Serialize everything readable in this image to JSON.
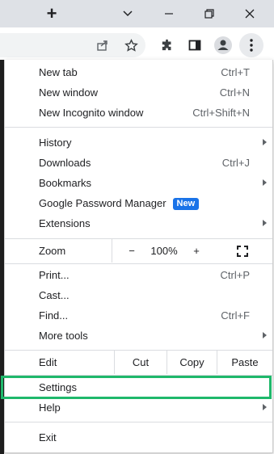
{
  "window": {
    "new_tab_symbol": "+",
    "icons": [
      "new-tab-icon",
      "tab-search-icon",
      "minimize-icon",
      "restore-icon",
      "close-icon"
    ]
  },
  "toolbar": {
    "icons": [
      "share-icon",
      "bookmark-star-icon",
      "extensions-icon",
      "side-panel-icon",
      "profile-icon",
      "menu-kebab-icon"
    ]
  },
  "menu": {
    "new_tab": {
      "label": "New tab",
      "shortcut": "Ctrl+T"
    },
    "new_window": {
      "label": "New window",
      "shortcut": "Ctrl+N"
    },
    "new_incognito": {
      "label": "New Incognito window",
      "shortcut": "Ctrl+Shift+N"
    },
    "history": {
      "label": "History"
    },
    "downloads": {
      "label": "Downloads",
      "shortcut": "Ctrl+J"
    },
    "bookmarks": {
      "label": "Bookmarks"
    },
    "password_manager": {
      "label": "Google Password Manager",
      "badge": "New"
    },
    "extensions": {
      "label": "Extensions"
    },
    "zoom": {
      "label": "Zoom",
      "minus": "−",
      "value": "100%",
      "plus": "+"
    },
    "print": {
      "label": "Print...",
      "shortcut": "Ctrl+P"
    },
    "cast": {
      "label": "Cast..."
    },
    "find": {
      "label": "Find...",
      "shortcut": "Ctrl+F"
    },
    "more_tools": {
      "label": "More tools"
    },
    "edit": {
      "label": "Edit",
      "cut": "Cut",
      "copy": "Copy",
      "paste": "Paste"
    },
    "settings": {
      "label": "Settings"
    },
    "help": {
      "label": "Help"
    },
    "exit": {
      "label": "Exit"
    }
  },
  "colors": {
    "highlight": "#1fb86b",
    "badge": "#1a73e8",
    "titlebar": "#dee1e6"
  }
}
